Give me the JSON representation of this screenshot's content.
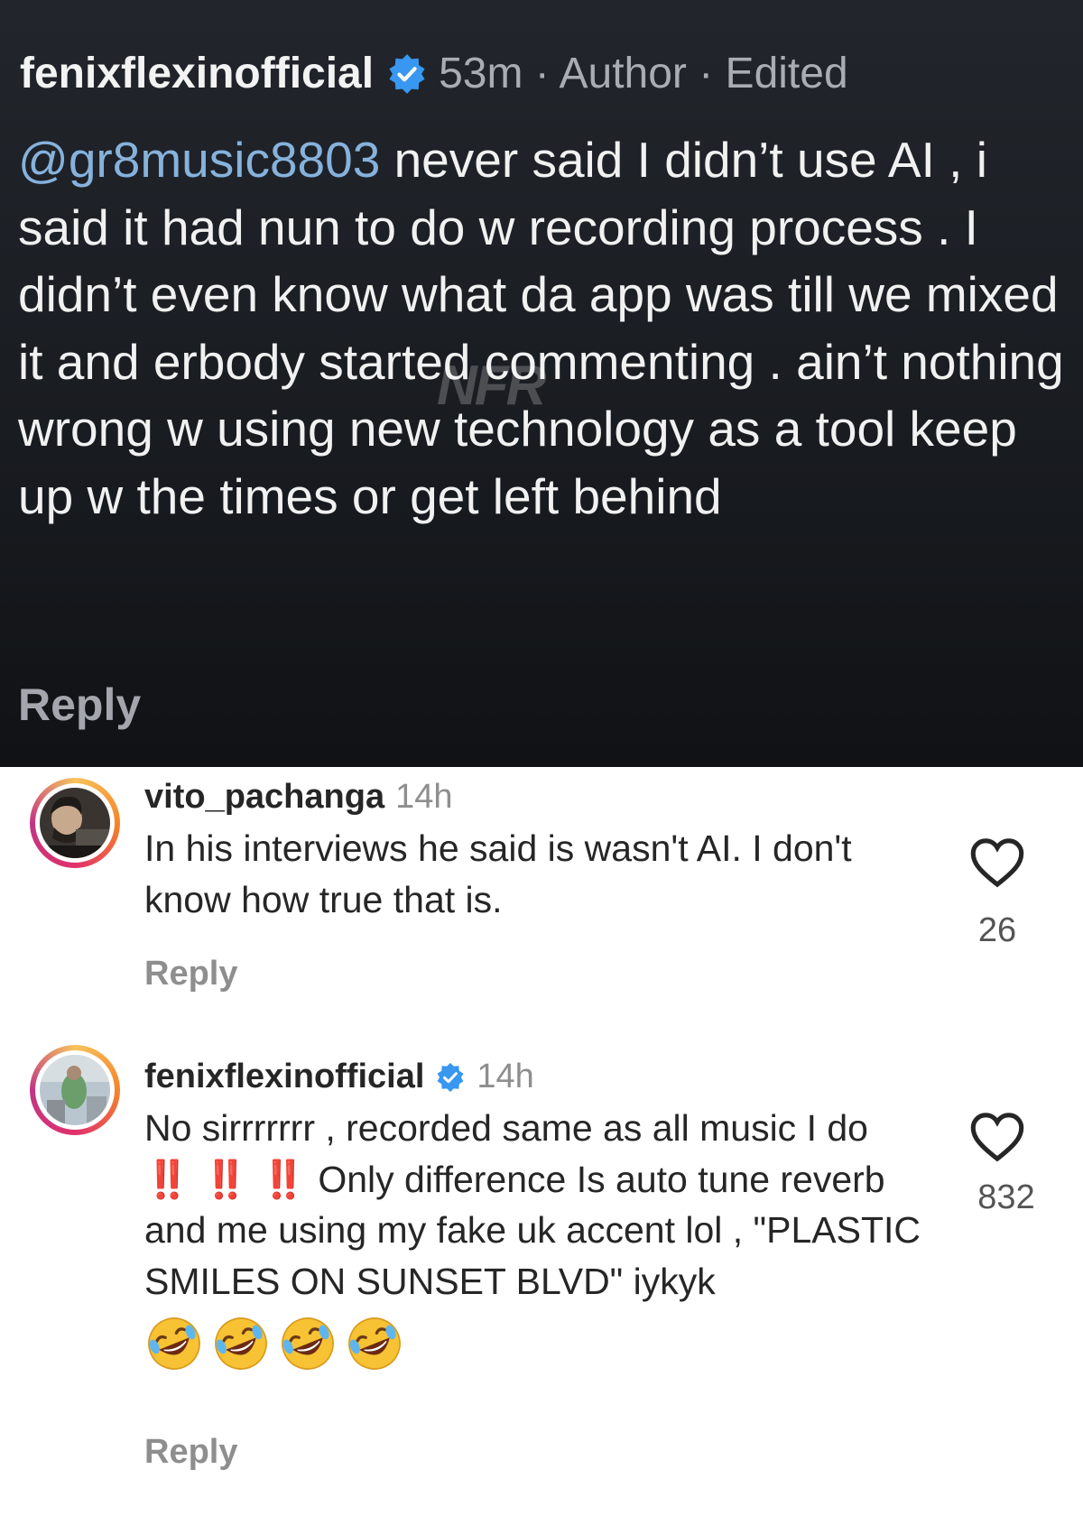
{
  "author_comment": {
    "username": "fenixflexinofficial",
    "meta": "53m · Author · Edited",
    "mention": "@gr8music8803",
    "text": " never said I didn’t use AI , i said it had nun to do w recording process . I didn’t even know what da app was till we mixed it and erbody started commenting . ain’t nothing wrong w using new technology as a tool keep up w the times or get left behind",
    "reply_label": "Reply",
    "watermark": "NFR"
  },
  "comments": [
    {
      "username": "vito_pachanga",
      "time": "14h",
      "verified": false,
      "text": "In his interviews he said is wasn't AI. I don't know how true that is.",
      "likes": "26",
      "reply_label": "Reply"
    },
    {
      "username": "fenixflexinofficial",
      "time": "14h",
      "verified": true,
      "text_before": "No sirrrrrrr , recorded same as all music I do ",
      "exclaim": "‼️ ‼️ ‼️",
      "text_after": " Only difference Is auto tune reverb and me using my fake uk accent lol , \"PLASTIC SMILES ON SUNSET BLVD\" iykyk",
      "emojis": [
        "rolling-on-floor-laughing",
        "rolling-on-floor-laughing",
        "rolling-on-floor-laughing",
        "rolling-on-floor-laughing"
      ],
      "likes": "832",
      "reply_label": "Reply"
    }
  ],
  "colors": {
    "verified_badge": "#3897f0",
    "mention": "#86b2dc",
    "exclaim": "#e0242a"
  }
}
